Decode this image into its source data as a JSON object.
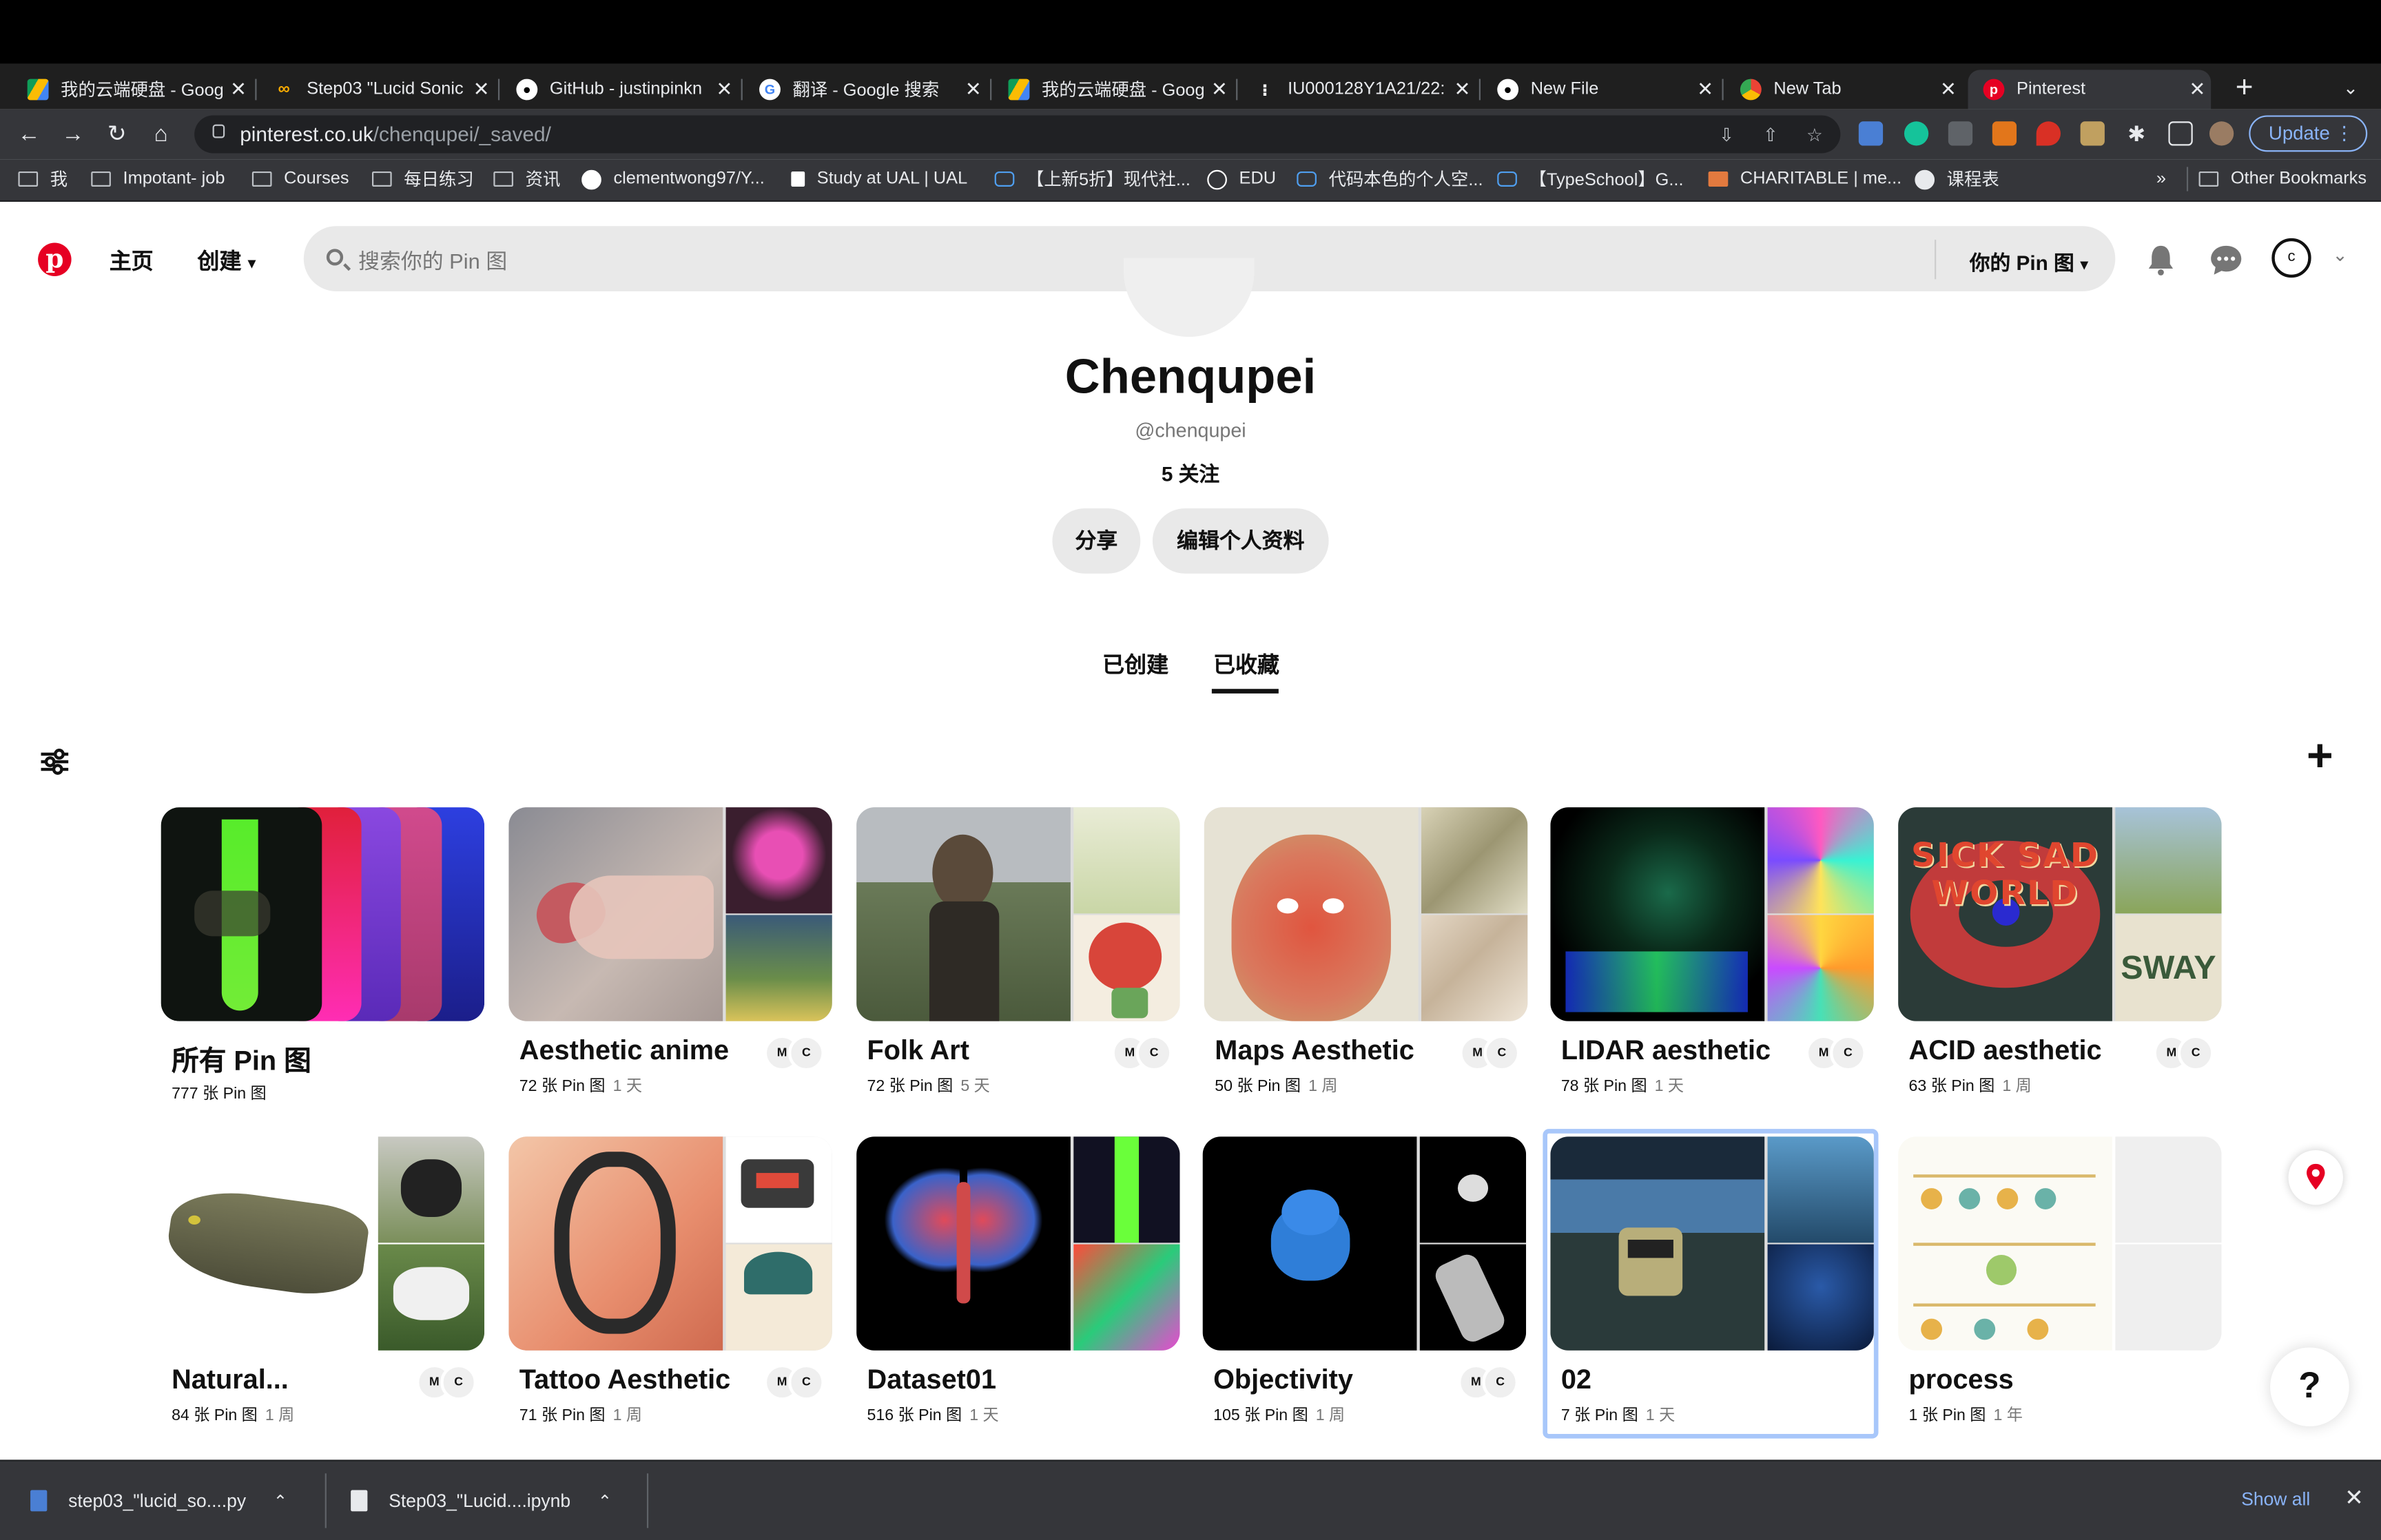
{
  "browser": {
    "tabs": [
      {
        "title": "我的云端硬盘 - Goog",
        "icon": "google-drive-icon"
      },
      {
        "title": "Step03 \"Lucid Sonic",
        "icon": "colab-icon"
      },
      {
        "title": "GitHub - justinpinkn",
        "icon": "github-icon"
      },
      {
        "title": "翻译 - Google 搜索",
        "icon": "google-icon"
      },
      {
        "title": "我的云端硬盘 - Goog",
        "icon": "google-drive-icon"
      },
      {
        "title": "IU000128Y1A21/22:",
        "icon": "page-icon"
      },
      {
        "title": "New File",
        "icon": "github-icon"
      },
      {
        "title": "New Tab",
        "icon": "chrome-icon"
      },
      {
        "title": "Pinterest",
        "icon": "pinterest-icon"
      }
    ],
    "active_tab_index": 8,
    "url_host": "pinterest.co.uk",
    "url_path": "/chenqupei/_saved/",
    "update_label": "Update",
    "bookmarks": [
      {
        "label": "我",
        "icon": "folder-icon"
      },
      {
        "label": "Impotant- job",
        "icon": "folder-icon"
      },
      {
        "label": "Courses",
        "icon": "folder-icon"
      },
      {
        "label": "每日练习",
        "icon": "folder-icon"
      },
      {
        "label": "资讯",
        "icon": "folder-icon"
      },
      {
        "label": "clementwong97/Y...",
        "icon": "github-icon"
      },
      {
        "label": "Study at UAL | UAL",
        "icon": "ual-icon"
      },
      {
        "label": "【上新5折】现代社...",
        "icon": "bilibili-icon"
      },
      {
        "label": "EDU",
        "icon": "google-icon"
      },
      {
        "label": "代码本色的个人空...",
        "icon": "bilibili-icon"
      },
      {
        "label": "【TypeSchool】G...",
        "icon": "bilibili-icon"
      },
      {
        "label": "CHARITABLE | me...",
        "icon": "cambridge-icon"
      },
      {
        "label": "课程表",
        "icon": "globe-icon"
      }
    ],
    "more_bookmarks": "»",
    "other_bookmarks": "Other Bookmarks"
  },
  "pinterest": {
    "nav_home": "主页",
    "nav_create": "创建",
    "search_placeholder": "搜索你的 Pin 图",
    "search_scope": "你的 Pin 图",
    "avatar_letter": "c",
    "profile": {
      "name": "Chenqupei",
      "handle": "@chenqupei",
      "following": "5 关注",
      "share": "分享",
      "edit": "编辑个人资料"
    },
    "tabs": {
      "created": "已创建",
      "saved": "已收藏"
    },
    "help": "?",
    "boards": [
      {
        "name": "所有 Pin 图",
        "count": "777 张 Pin 图",
        "age": "",
        "collab": false
      },
      {
        "name": "Aesthetic anime",
        "count": "72 张 Pin 图",
        "age": "1 天",
        "collab": true
      },
      {
        "name": "Folk Art",
        "count": "72 张 Pin 图",
        "age": "5 天",
        "collab": true
      },
      {
        "name": "Maps Aesthetic",
        "count": "50 张 Pin 图",
        "age": "1 周",
        "collab": true
      },
      {
        "name": "LIDAR aesthetic",
        "count": "78 张 Pin 图",
        "age": "1 天",
        "collab": true
      },
      {
        "name": "ACID aesthetic",
        "count": "63 张 Pin 图",
        "age": "1 周",
        "collab": true
      },
      {
        "name": "Natural...",
        "count": "84 张 Pin 图",
        "age": "1 周",
        "collab": true
      },
      {
        "name": "Tattoo Aesthetic",
        "count": "71 张 Pin 图",
        "age": "1 周",
        "collab": true
      },
      {
        "name": "Dataset01",
        "count": "516 张 Pin 图",
        "age": "1 天",
        "collab": false
      },
      {
        "name": "Objectivity",
        "count": "105 张 Pin 图",
        "age": "1 周",
        "collab": true
      },
      {
        "name": "02",
        "count": "7 张 Pin 图",
        "age": "1 天",
        "collab": false
      },
      {
        "name": "process",
        "count": "1 张 Pin 图",
        "age": "1 年",
        "collab": false
      }
    ],
    "collab_letters": [
      "M",
      "C"
    ],
    "cover_text": {
      "acid_main": "SICK SAD WORLD",
      "acid_sub": "SWAY"
    }
  },
  "downloads": {
    "items": [
      {
        "name": "step03_\"lucid_so....py"
      },
      {
        "name": "Step03_\"Lucid....ipynb"
      }
    ],
    "show_all": "Show all"
  },
  "colors": {
    "pinterest_red": "#e60023",
    "selected_outline": "#a8c7fa",
    "chrome_dark": "#35363a"
  }
}
